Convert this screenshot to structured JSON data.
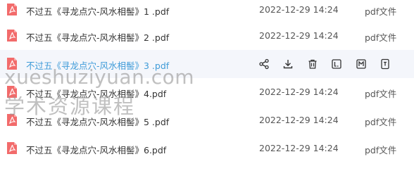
{
  "files": [
    {
      "name": "不过五《寻龙点穴-风水相髻》1 .pdf",
      "date": "2022-12-29 14:24",
      "type": "pdf文件",
      "icon": "pdf-file-icon"
    },
    {
      "name": "不过五《寻龙点穴-风水相髻》2 .pdf",
      "date": "2022-12-29 14:24",
      "type": "pdf文件",
      "icon": "pdf-file-icon"
    },
    {
      "name": "不过五《寻龙点穴-风水相髻》3 .pdf",
      "date": "",
      "type": "",
      "icon": "pdf-file-icon"
    },
    {
      "name": "不过五《寻龙点穴-风水相髻》4.pdf",
      "date": "2022-12-29 14:24",
      "type": "pdf文件",
      "icon": "pdf-file-icon"
    },
    {
      "name": "不过五《寻龙点穴-风水相髻》5 .pdf",
      "date": "2022-12-29 14:24",
      "type": "pdf文件",
      "icon": "pdf-file-icon"
    },
    {
      "name": "不过五《寻龙点穴-风水相髻》6.pdf",
      "date": "2022-12-29 14:24",
      "type": "pdf文件",
      "icon": "pdf-file-icon"
    }
  ],
  "hover_actions": [
    "share-icon",
    "download-icon",
    "delete-icon",
    "rename-icon",
    "move-icon",
    "more-icon"
  ],
  "watermark": {
    "line1": "xueshuziyuan.com",
    "line2": "学术资源课程"
  },
  "colors": {
    "pdf_red": "#f26b6b",
    "link_blue": "#3e9bd8",
    "hover_bg": "#f4f6fb"
  }
}
